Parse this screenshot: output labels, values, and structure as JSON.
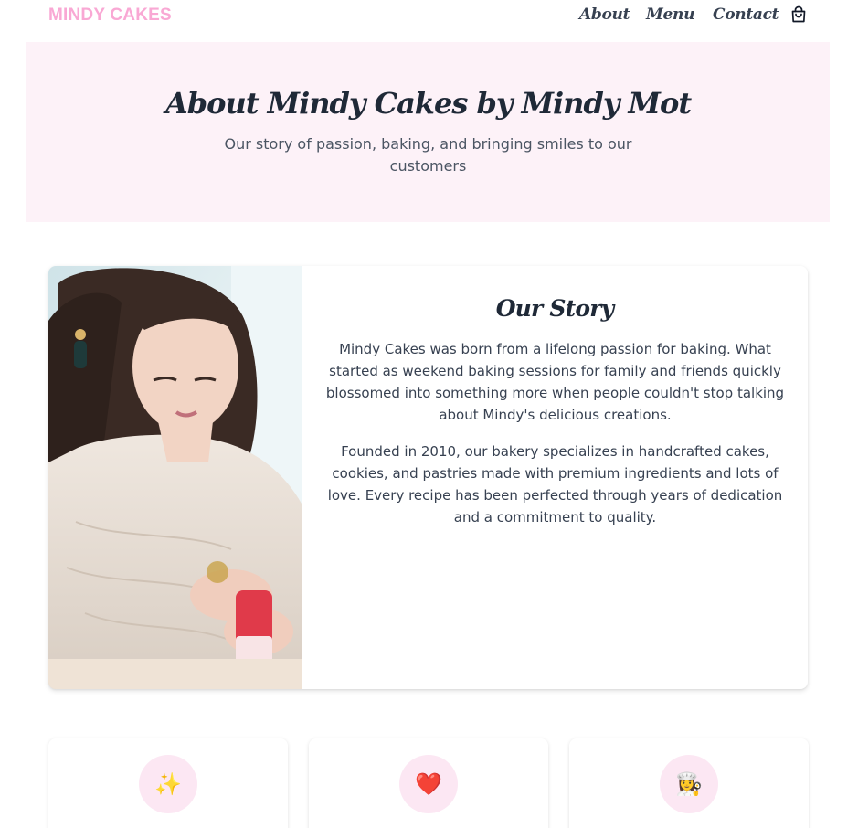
{
  "header": {
    "brand": "MINDY CAKES",
    "nav": [
      {
        "label": "About"
      },
      {
        "label": "Menu"
      },
      {
        "label": "Contact"
      }
    ],
    "cart_icon": "shopping-bag-icon"
  },
  "hero": {
    "title": "About Mindy Cakes by Mindy Mot",
    "subtitle": "Our story of passion, baking, and bringing smiles to our customers"
  },
  "story": {
    "title": "Our Story",
    "paragraphs": [
      "Mindy Cakes was born from a lifelong passion for baking. What started as weekend baking sessions for family and friends quickly blossomed into something more when people couldn't stop talking about Mindy's delicious creations.",
      "Founded in 2010, our bakery specializes in handcrafted cakes, cookies, and pastries made with premium ingredients and lots of love. Every recipe has been perfected through years of dedication and a commitment to quality."
    ],
    "photo_icon": "mindy-photo"
  },
  "features": [
    {
      "icon": "sparkles-icon",
      "glyph": "✨"
    },
    {
      "icon": "heart-icon",
      "glyph": "❤️"
    },
    {
      "icon": "baker-icon",
      "glyph": "👩‍🍳"
    }
  ],
  "colors": {
    "brand": "#f9a8d4",
    "hero_bg": "#fdf2f8",
    "icon_bg": "#fce7f3",
    "heading": "#1f2937",
    "text": "#374151"
  }
}
